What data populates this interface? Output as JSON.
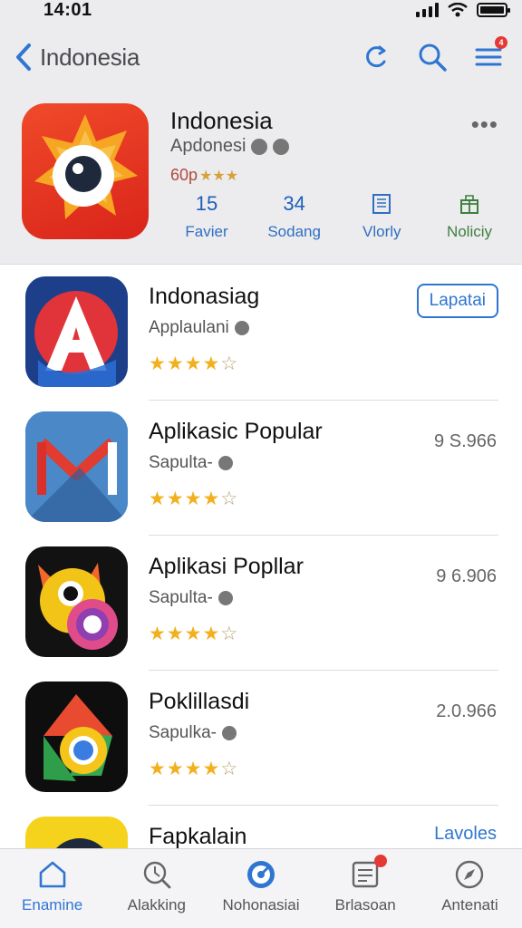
{
  "status_bar": {
    "time": "14:01"
  },
  "header": {
    "back_label": "Indonesia",
    "actions": [
      {
        "icon": "refresh-icon"
      },
      {
        "icon": "search-icon"
      },
      {
        "icon": "menu-icon",
        "badge": "4"
      }
    ],
    "app": {
      "title": "Indonesia",
      "subtitle": "Apdonesi",
      "rating_text": "60p",
      "rating_stars": "★★★",
      "more_label": "•••",
      "stats": [
        {
          "value": "15",
          "label": "Favier"
        },
        {
          "value": "34",
          "label": "Sodang"
        },
        {
          "icon": "building-icon",
          "label": "Vlorly"
        },
        {
          "icon": "gift-icon",
          "label": "Noliciy"
        }
      ]
    }
  },
  "list": [
    {
      "title": "Indonasiag",
      "subtitle": "Applaulani",
      "stars": "★★★★",
      "empty_star": "☆",
      "action": "Lapatai"
    },
    {
      "title": "Aplikasic Popular",
      "subtitle": "Sapulta-",
      "stars": "★★★★",
      "empty_star": "☆",
      "meta": "9 S.966"
    },
    {
      "title": "Aplikasi Popllar",
      "subtitle": "Sapulta-",
      "stars": "★★★★",
      "empty_star": "☆",
      "meta": "9 6.906"
    },
    {
      "title": "Poklillasdi",
      "subtitle": "Sapulka-",
      "stars": "★★★★",
      "empty_star": "☆",
      "meta": "2.0.966"
    },
    {
      "title": "Fapkalain",
      "link": "Lavoles"
    }
  ],
  "tabbar": [
    {
      "label": "Enamine",
      "icon": "home-icon",
      "active": true
    },
    {
      "label": "Alakking",
      "icon": "search-icon"
    },
    {
      "label": "Nohonasiai",
      "icon": "globe-icon"
    },
    {
      "label": "Brlasoan",
      "icon": "news-icon"
    },
    {
      "label": "Antenati",
      "icon": "compass-icon"
    }
  ],
  "colors": {
    "accent": "#2f76d2",
    "star": "#f2b01e",
    "header_bg": "#ececef"
  }
}
